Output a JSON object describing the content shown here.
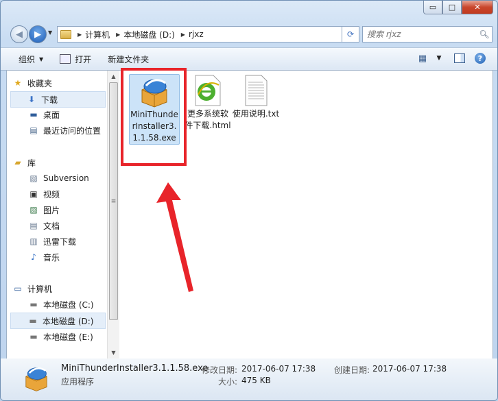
{
  "window": {
    "controls": {
      "minimize": "▭",
      "maximize": "□",
      "close": "✕"
    }
  },
  "address": {
    "crumbs": [
      "计算机",
      "本地磁盘 (D:)",
      "rjxz"
    ],
    "search_placeholder": "搜索 rjxz"
  },
  "toolbar": {
    "organize_label": "组织",
    "open_label": "打开",
    "new_folder_label": "新建文件夹"
  },
  "nav": {
    "favorites_label": "收藏夹",
    "downloads_label": "下载",
    "desktop_label": "桌面",
    "recent_label": "最近访问的位置",
    "libraries_label": "库",
    "subversion_label": "Subversion",
    "videos_label": "视频",
    "pictures_label": "图片",
    "documents_label": "文档",
    "thunder_label": "迅雷下载",
    "music_label": "音乐",
    "computer_label": "计算机",
    "drive_c_label": "本地磁盘 (C:)",
    "drive_d_label": "本地磁盘 (D:)",
    "drive_e_label": "本地磁盘 (E:)"
  },
  "files": [
    {
      "name": "MiniThunderInstaller3.1.1.58.exe",
      "icon": "installer-icon"
    },
    {
      "name": "更多系统软件下载.html",
      "icon": "ie-html-icon"
    },
    {
      "name": "使用说明.txt",
      "icon": "text-document-icon"
    }
  ],
  "status": {
    "filename": "MiniThunderInstaller3.1.1.58.exe",
    "type": "应用程序",
    "modified_label": "修改日期:",
    "modified_value": "2017-06-07 17:38",
    "created_label": "创建日期:",
    "created_value": "2017-06-07 17:38",
    "size_label": "大小:",
    "size_value": "475 KB"
  },
  "colors": {
    "highlight_box": "#e8242a",
    "selection": "#cce3f8"
  }
}
